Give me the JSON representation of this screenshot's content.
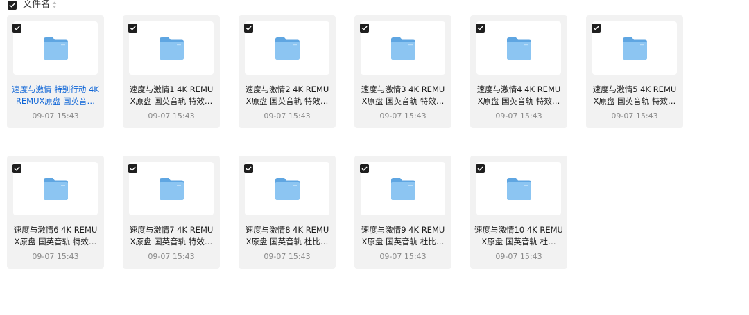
{
  "header": {
    "title": "文件名",
    "checked": true,
    "sort_icon": "sort-icon"
  },
  "colors": {
    "accent": "#0b63d6",
    "card_bg": "#f2f2f2",
    "folder": "#7ab8ec",
    "checkbox": "#1f1f1f"
  },
  "files": [
    {
      "name": "速度与激情 特别行动 4K REMUX原盘 国英音…",
      "date": "09-07 15:43",
      "highlight": true,
      "checked": true,
      "icon": "folder-icon"
    },
    {
      "name": "速度与激情1 4K REMUX原盘 国英音轨 特效…",
      "date": "09-07 15:43",
      "highlight": false,
      "checked": true,
      "icon": "folder-icon"
    },
    {
      "name": "速度与激情2 4K REMUX原盘 国英音轨 特效…",
      "date": "09-07 15:43",
      "highlight": false,
      "checked": true,
      "icon": "folder-icon"
    },
    {
      "name": "速度与激情3 4K REMUX原盘 国英音轨 特效…",
      "date": "09-07 15:43",
      "highlight": false,
      "checked": true,
      "icon": "folder-icon"
    },
    {
      "name": "速度与激情4 4K REMUX原盘 国英音轨 特效…",
      "date": "09-07 15:43",
      "highlight": false,
      "checked": true,
      "icon": "folder-icon"
    },
    {
      "name": "速度与激情5 4K REMUX原盘 国英音轨 特效…",
      "date": "09-07 15:43",
      "highlight": false,
      "checked": true,
      "icon": "folder-icon"
    },
    {
      "name": "速度与激情6 4K REMUX原盘 国英音轨 特效…",
      "date": "09-07 15:43",
      "highlight": false,
      "checked": true,
      "icon": "folder-icon"
    },
    {
      "name": "速度与激情7 4K REMUX原盘 国英音轨 特效…",
      "date": "09-07 15:43",
      "highlight": false,
      "checked": true,
      "icon": "folder-icon"
    },
    {
      "name": "速度与激情8 4K REMUX原盘 国英音轨 杜比…",
      "date": "09-07 15:43",
      "highlight": false,
      "checked": true,
      "icon": "folder-icon"
    },
    {
      "name": "速度与激情9 4K REMUX原盘 国英音轨 杜比…",
      "date": "09-07 15:43",
      "highlight": false,
      "checked": true,
      "icon": "folder-icon"
    },
    {
      "name": "速度与激情10 4K REMUX原盘 国英音轨 杜…",
      "date": "09-07 15:43",
      "highlight": false,
      "checked": true,
      "icon": "folder-icon"
    }
  ]
}
